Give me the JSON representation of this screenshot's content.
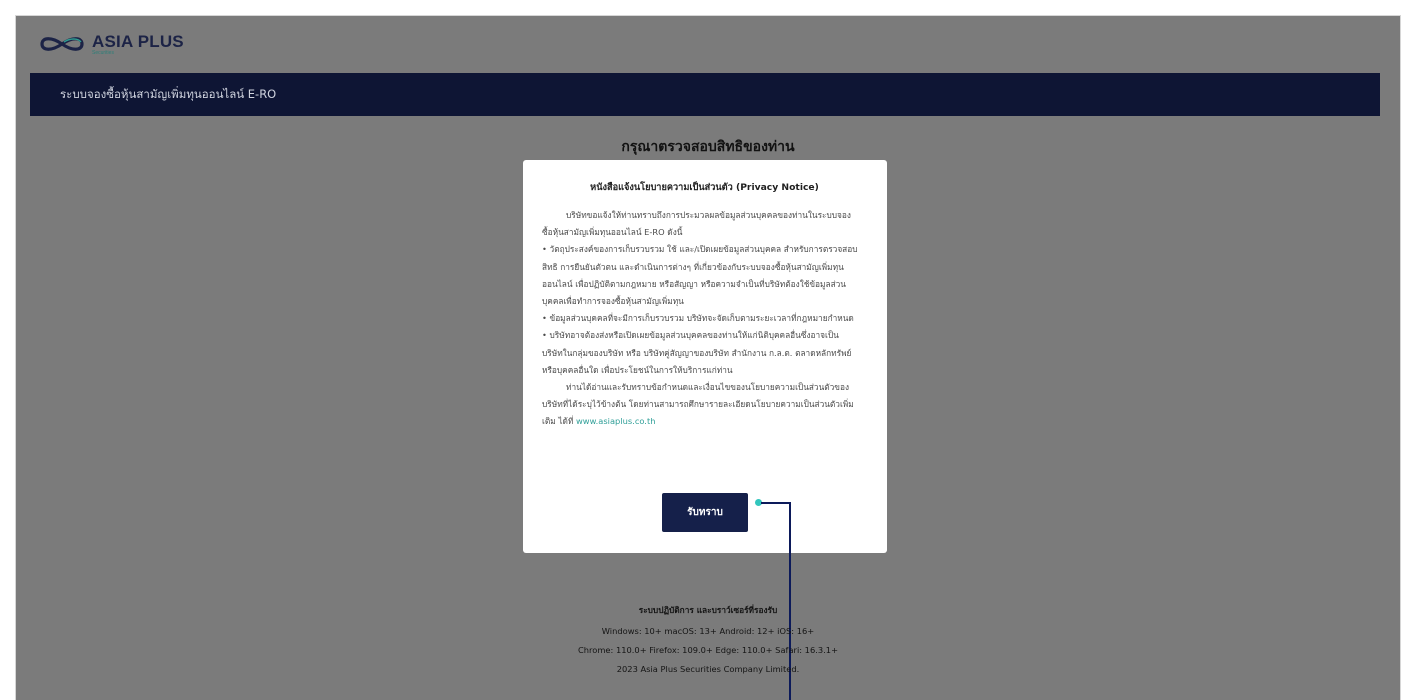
{
  "brand": {
    "name": "ASIA PLUS",
    "sub": "Securities"
  },
  "navbar": {
    "title": "ระบบจองซื้อหุ้นสามัญเพิ่มทุนออนไลน์ E-RO"
  },
  "page": {
    "title": "กรุณาตรวจสอบสิทธิของท่าน"
  },
  "modal": {
    "title": "หนังสือแจ้งนโยบายความเป็นส่วนตัว (Privacy Notice)",
    "intro": "บริษัทขอแจ้งให้ท่านทราบถึงการประมวลผลข้อมูลส่วนบุคคลของท่านในระบบจองซื้อหุ้นสามัญเพิ่มทุนออนไลน์ E-RO ดังนี้",
    "bullet1": "•    วัตถุประสงค์ของการเก็บรวบรวม ใช้ และ/เปิดเผยข้อมูลส่วนบุคคล สำหรับการตรวจสอบสิทธิ การยืนยันตัวตน และดำเนินการต่างๆ ที่เกี่ยวข้องกับระบบจองซื้อหุ้นสามัญเพิ่มทุนออนไลน์ เพื่อปฏิบัติตามกฎหมาย หรือสัญญา หรือความจำเป็นที่บริษัทต้องใช้ข้อมูลส่วนบุคคลเพื่อทำการจองซื้อหุ้นสามัญเพิ่มทุน",
    "bullet2": "•    ข้อมูลส่วนบุคคลที่จะมีการเก็บรวบรวม บริษัทจะจัดเก็บตามระยะเวลาที่กฎหมายกำหนด",
    "bullet3": "•    บริษัทอาจต้องส่งหรือเปิดเผยข้อมูลส่วนบุคคลของท่านให้แก่นิติบุคคลอื่นซึ่งอาจเป็นบริษัทในกลุ่มของบริษัท หรือ บริษัทคู่สัญญาของบริษัท สำนักงาน ก.ล.ต. ตลาดหลักทรัพย์ หรือบุคคลอื่นใด เพื่อประโยชน์ในการให้บริการแก่ท่าน",
    "closing": "ท่านได้อ่านและรับทราบข้อกำหนดและเงื่อนไขของนโยบายความเป็นส่วนตัวของบริษัทที่ได้ระบุไว้ข้างต้น โดยท่านสามารถศึกษารายละเอียดนโยบายความเป็นส่วนตัวเพิ่มเติม ได้ที่ ",
    "link": "www.asiaplus.co.th",
    "accept_label": "รับทราบ"
  },
  "footer": {
    "title": "ระบบปฏิบัติการ และบราว์เซอร์ที่รองรับ",
    "os": "Windows: 10+   macOS: 13+   Android: 12+   iOS: 16+",
    "browsers": "Chrome: 110.0+   Firefox: 109.0+   Edge: 110.0+   Safari: 16.3.1+",
    "copyright": "2023 Asia Plus Securities Company Limited."
  },
  "colors": {
    "overlay": "#7b7b7b",
    "navbar": "#0e1534",
    "button": "#15204a",
    "link": "#2f9f98",
    "callout_dot": "#32c6bd",
    "callout_line": "#0c1a5a"
  },
  "icons": {
    "logo": "infinity-logo-icon"
  }
}
